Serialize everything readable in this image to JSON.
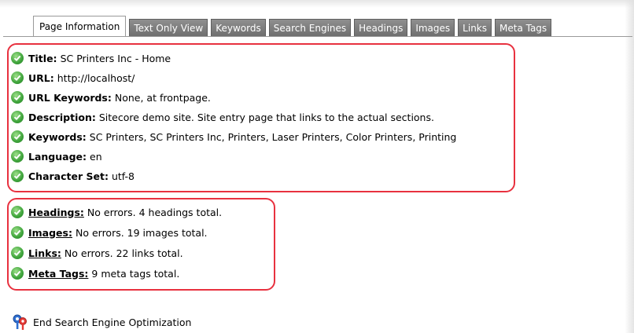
{
  "tabs": [
    {
      "label": "Page Information",
      "active": true
    },
    {
      "label": "Text Only View",
      "active": false
    },
    {
      "label": "Keywords",
      "active": false
    },
    {
      "label": "Search Engines",
      "active": false
    },
    {
      "label": "Headings",
      "active": false
    },
    {
      "label": "Images",
      "active": false
    },
    {
      "label": "Links",
      "active": false
    },
    {
      "label": "Meta Tags",
      "active": false
    }
  ],
  "page_info": [
    {
      "label": "Title:",
      "value": "SC Printers Inc - Home"
    },
    {
      "label": "URL:",
      "value": "http://localhost/"
    },
    {
      "label": "URL Keywords:",
      "value": "None, at frontpage."
    },
    {
      "label": "Description:",
      "value": "Sitecore demo site. Site entry page that links to the actual sections."
    },
    {
      "label": "Keywords:",
      "value": "SC Printers, SC Printers Inc, Printers, Laser Printers, Color Printers, Printing"
    },
    {
      "label": "Language:",
      "value": "en"
    },
    {
      "label": "Character Set:",
      "value": "utf-8"
    }
  ],
  "summary": [
    {
      "label": "Headings:",
      "value": "No errors. 4 headings total."
    },
    {
      "label": "Images:",
      "value": "No errors. 19 images total."
    },
    {
      "label": "Links:",
      "value": "No errors. 22 links total."
    },
    {
      "label": "Meta Tags:",
      "value": "9 meta tags total."
    }
  ],
  "footer": {
    "label": "End Search Engine Optimization"
  },
  "icons": {
    "status": "check-circle-icon",
    "seo": "seo-keys-icon"
  },
  "colors": {
    "highlight": "#e8313f",
    "check": "#3da33a",
    "tab_inactive": "#7f7f7f"
  }
}
